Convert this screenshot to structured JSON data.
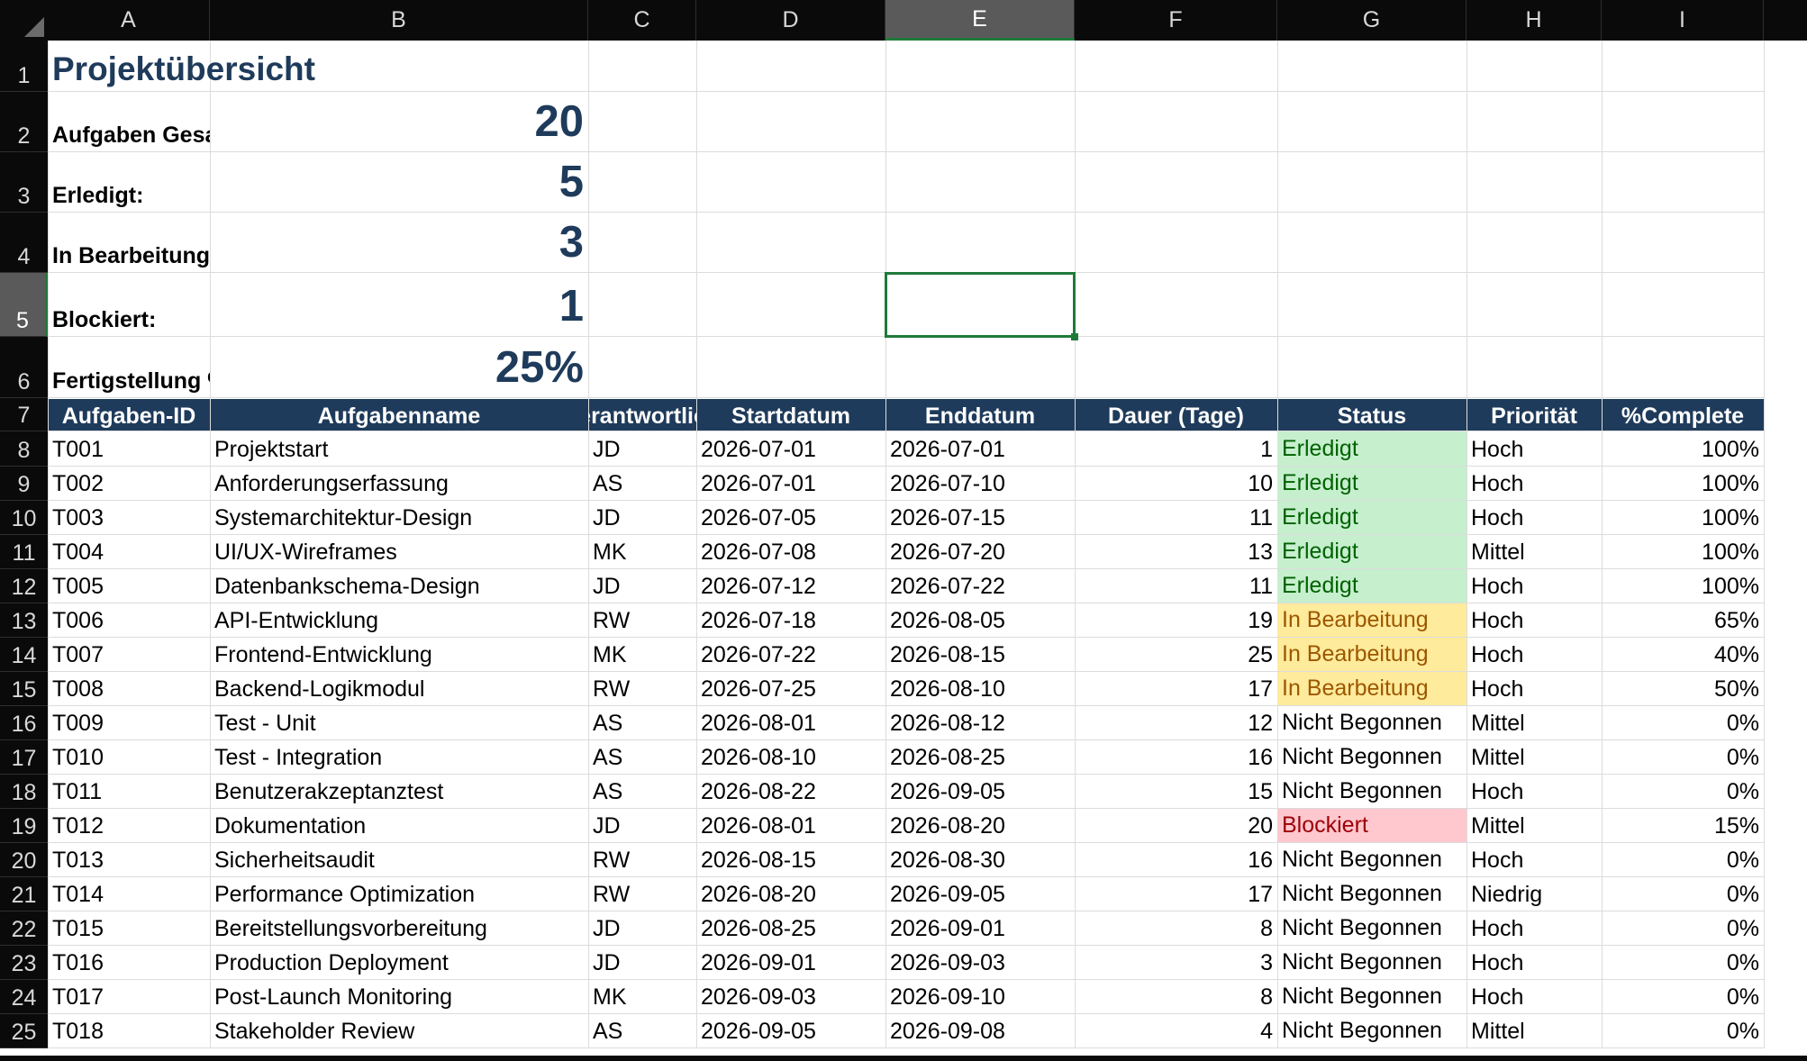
{
  "columns": [
    "A",
    "B",
    "C",
    "D",
    "E",
    "F",
    "G",
    "H",
    "I"
  ],
  "active_column": "E",
  "active_row": 5,
  "row_numbers": [
    "1",
    "2",
    "3",
    "4",
    "5",
    "6",
    "7",
    "8",
    "9",
    "10",
    "11",
    "12",
    "13",
    "14",
    "15",
    "16",
    "17",
    "18",
    "19",
    "20",
    "21",
    "22",
    "23",
    "24",
    "25"
  ],
  "title": "Projektübersicht",
  "summary": [
    {
      "label": "Aufgaben Gesamt:",
      "value": "20"
    },
    {
      "label": "Erledigt:",
      "value": "5"
    },
    {
      "label": "In Bearbeitung:",
      "value": "3"
    },
    {
      "label": "Blockiert:",
      "value": "1"
    },
    {
      "label": "Fertigstellung %:",
      "value": "25%"
    }
  ],
  "table_headers": [
    "Aufgaben-ID",
    "Aufgabenname",
    "Verantwortlich",
    "Startdatum",
    "Enddatum",
    "Dauer (Tage)",
    "Status",
    "Priorität",
    "%Complete"
  ],
  "tasks": [
    [
      "T001",
      "Projektstart",
      "JD",
      "2026-07-01",
      "2026-07-01",
      "1",
      "Erledigt",
      "Hoch",
      "100%"
    ],
    [
      "T002",
      "Anforderungserfassung",
      "AS",
      "2026-07-01",
      "2026-07-10",
      "10",
      "Erledigt",
      "Hoch",
      "100%"
    ],
    [
      "T003",
      "Systemarchitektur-Design",
      "JD",
      "2026-07-05",
      "2026-07-15",
      "11",
      "Erledigt",
      "Hoch",
      "100%"
    ],
    [
      "T004",
      "UI/UX-Wireframes",
      "MK",
      "2026-07-08",
      "2026-07-20",
      "13",
      "Erledigt",
      "Mittel",
      "100%"
    ],
    [
      "T005",
      "Datenbankschema-Design",
      "JD",
      "2026-07-12",
      "2026-07-22",
      "11",
      "Erledigt",
      "Hoch",
      "100%"
    ],
    [
      "T006",
      "API-Entwicklung",
      "RW",
      "2026-07-18",
      "2026-08-05",
      "19",
      "In Bearbeitung",
      "Hoch",
      "65%"
    ],
    [
      "T007",
      "Frontend-Entwicklung",
      "MK",
      "2026-07-22",
      "2026-08-15",
      "25",
      "In Bearbeitung",
      "Hoch",
      "40%"
    ],
    [
      "T008",
      "Backend-Logikmodul",
      "RW",
      "2026-07-25",
      "2026-08-10",
      "17",
      "In Bearbeitung",
      "Hoch",
      "50%"
    ],
    [
      "T009",
      "Test - Unit",
      "AS",
      "2026-08-01",
      "2026-08-12",
      "12",
      "Nicht Begonnen",
      "Mittel",
      "0%"
    ],
    [
      "T010",
      "Test - Integration",
      "AS",
      "2026-08-10",
      "2026-08-25",
      "16",
      "Nicht Begonnen",
      "Mittel",
      "0%"
    ],
    [
      "T011",
      "Benutzerakzeptanztest",
      "AS",
      "2026-08-22",
      "2026-09-05",
      "15",
      "Nicht Begonnen",
      "Hoch",
      "0%"
    ],
    [
      "T012",
      "Dokumentation",
      "JD",
      "2026-08-01",
      "2026-08-20",
      "20",
      "Blockiert",
      "Mittel",
      "15%"
    ],
    [
      "T013",
      "Sicherheitsaudit",
      "RW",
      "2026-08-15",
      "2026-08-30",
      "16",
      "Nicht Begonnen",
      "Hoch",
      "0%"
    ],
    [
      "T014",
      "Performance Optimization",
      "RW",
      "2026-08-20",
      "2026-09-05",
      "17",
      "Nicht Begonnen",
      "Niedrig",
      "0%"
    ],
    [
      "T015",
      "Bereitstellungsvorbereitung",
      "JD",
      "2026-08-25",
      "2026-09-01",
      "8",
      "Nicht Begonnen",
      "Hoch",
      "0%"
    ],
    [
      "T016",
      "Production Deployment",
      "JD",
      "2026-09-01",
      "2026-09-03",
      "3",
      "Nicht Begonnen",
      "Hoch",
      "0%"
    ],
    [
      "T017",
      "Post-Launch Monitoring",
      "MK",
      "2026-09-03",
      "2026-09-10",
      "8",
      "Nicht Begonnen",
      "Hoch",
      "0%"
    ],
    [
      "T018",
      "Stakeholder Review",
      "AS",
      "2026-09-05",
      "2026-09-08",
      "4",
      "Nicht Begonnen",
      "Mittel",
      "0%"
    ]
  ],
  "colors": {
    "header_bg": "#1f3b5b",
    "title": "#1f3b5b",
    "done_bg": "#c6efce",
    "done_fg": "#006100",
    "progress_bg": "#ffeb9c",
    "progress_fg": "#9c5700",
    "blocked_bg": "#ffc7ce",
    "blocked_fg": "#9c0006",
    "selection": "#1f7a3a"
  }
}
